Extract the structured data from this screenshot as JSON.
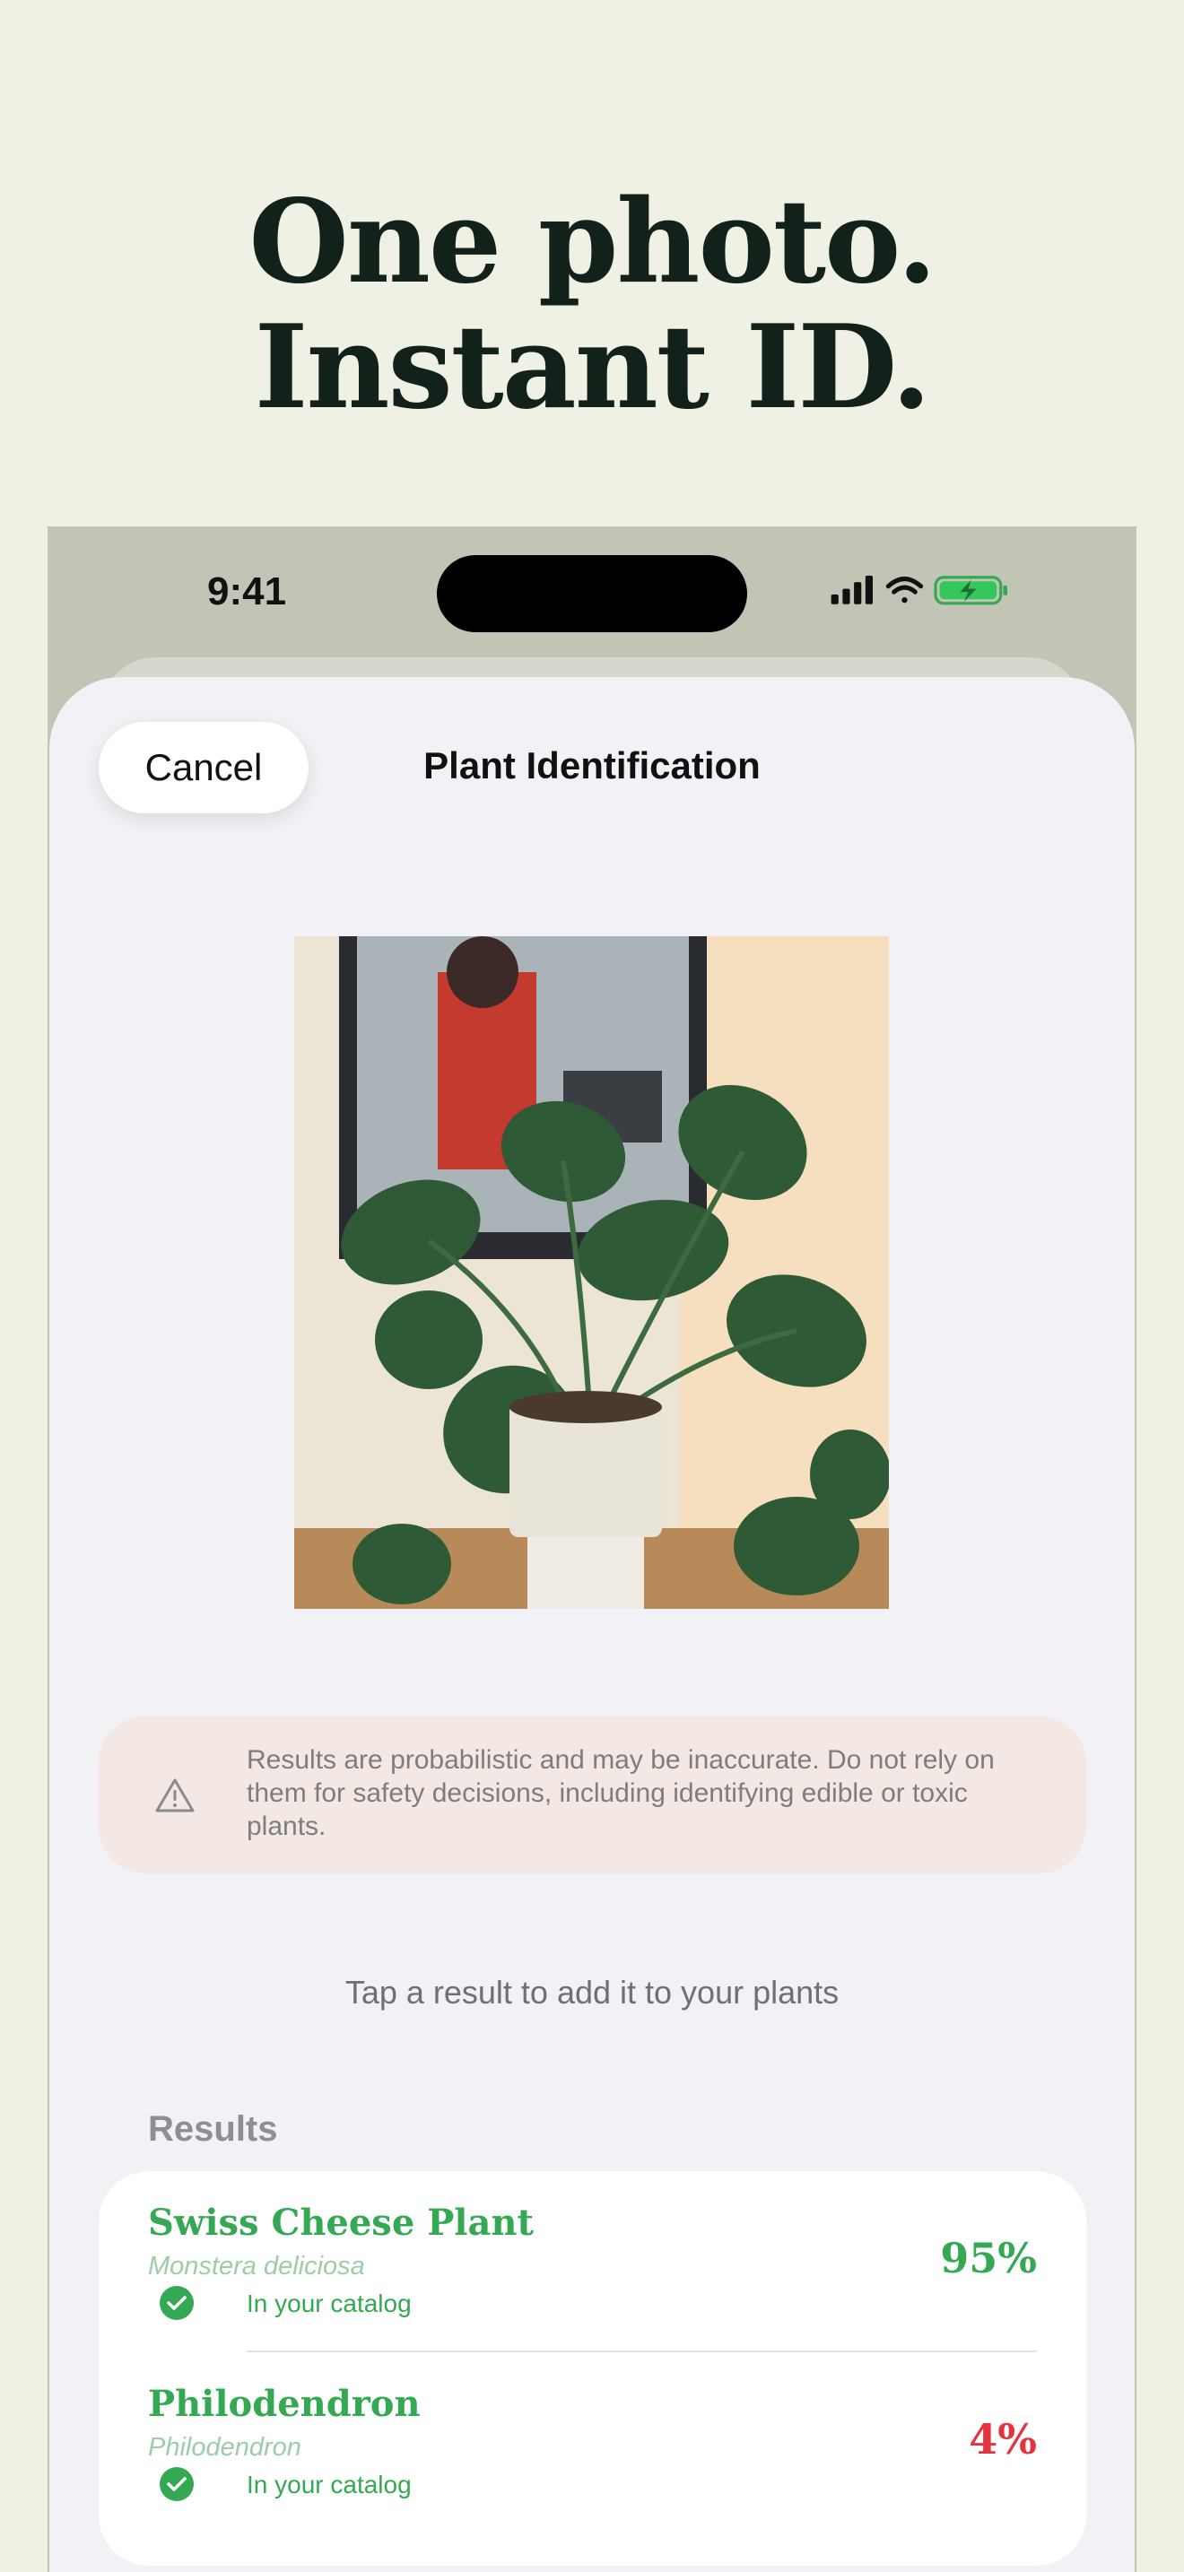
{
  "headline": {
    "line1": "One photo.",
    "line2": "Instant ID."
  },
  "status_bar": {
    "time": "9:41",
    "icons": [
      "cellular-signal-icon",
      "wifi-icon",
      "battery-charging-icon"
    ]
  },
  "nav": {
    "cancel_label": "Cancel",
    "title": "Plant Identification"
  },
  "disclaimer": {
    "icon": "warning-icon",
    "text": "Results are probabilistic and may be inaccurate. Do not rely on them for safety decisions, including identifying edible or toxic plants."
  },
  "hint": "Tap a result to add it to your plants",
  "results": {
    "section_label": "Results",
    "items": [
      {
        "common_name": "Swiss Cheese Plant",
        "scientific_name": "Monstera deliciosa",
        "catalog_label": "In your catalog",
        "confidence": "95%",
        "confidence_color": "#34a853"
      },
      {
        "common_name": "Philodendron",
        "scientific_name": "Philodendron",
        "catalog_label": "In your catalog",
        "confidence": "4%",
        "confidence_color": "#e5333d"
      }
    ]
  },
  "colors": {
    "background": "#eff1e5",
    "accent_green": "#34a853",
    "low_confidence_red": "#e5333d",
    "sheet": "#f2f1f6",
    "disclaimer_bg": "#f3e8e3"
  }
}
